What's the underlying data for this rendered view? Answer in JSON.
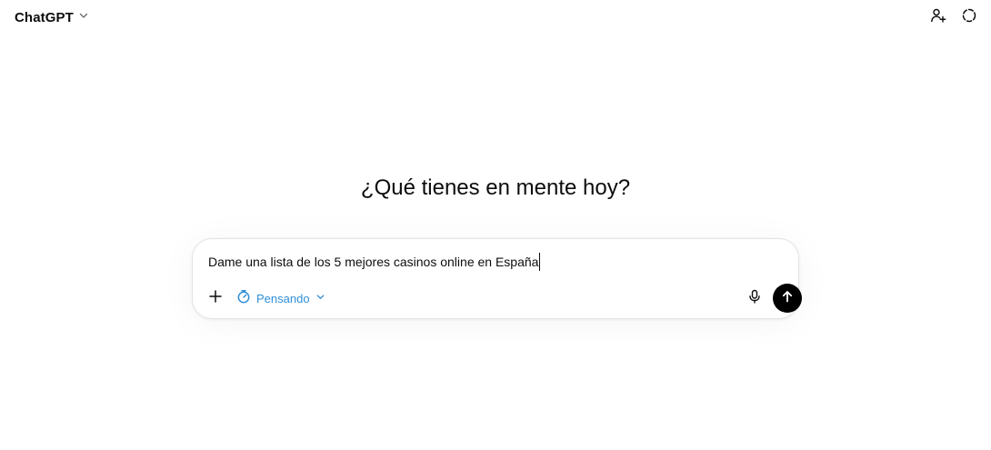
{
  "header": {
    "model_name": "ChatGPT",
    "model_icon": "chevron-down-icon",
    "right_icons": [
      "add-person-icon",
      "temporary-chat-icon"
    ]
  },
  "main": {
    "heading": "¿Qué tienes en mente hoy?"
  },
  "composer": {
    "input_value": "Dame una lista de los 5 mejores casinos online en España",
    "mode_label": "Pensando",
    "icons": [
      "plus-icon",
      "stopwatch-icon",
      "chevron-down-icon",
      "microphone-icon",
      "arrow-up-icon"
    ],
    "accent_color": "#2f8fd8",
    "send_button_color": "#000000"
  }
}
